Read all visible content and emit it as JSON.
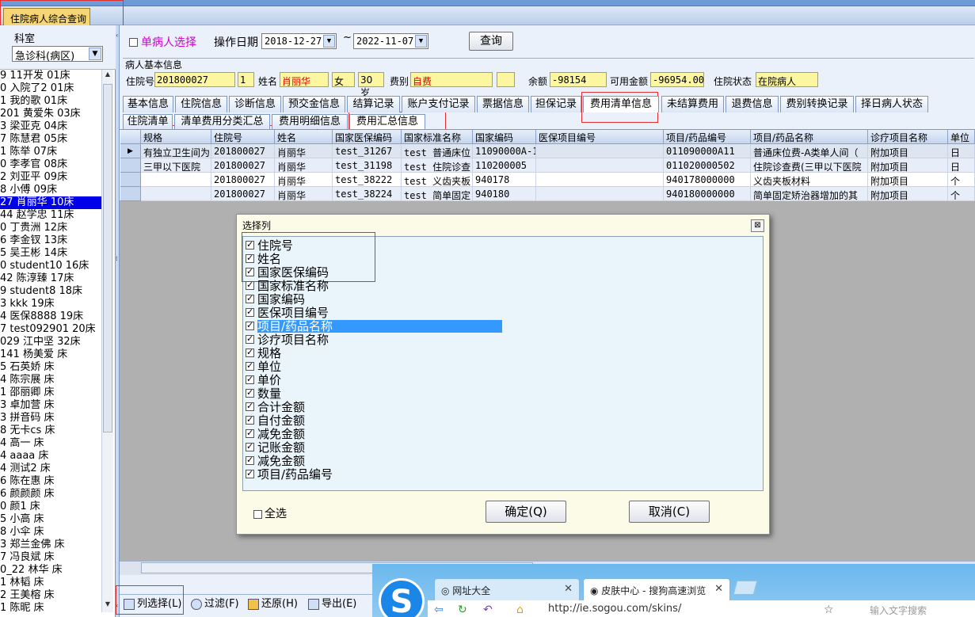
{
  "window": {
    "tab_title": "住院病人综合查询"
  },
  "left_panel": {
    "dept_label": "科室",
    "dept_value": "急诊科(病区)",
    "patients": [
      "9 11开发 01床",
      "0 入院了2 01床",
      "1 我的歌 01床",
      "201 黄爱朱 03床",
      "3 梁亚克 04床",
      "7 陈慧君 05床",
      "1 陈举 07床",
      "0 李孝官 08床",
      "2 刘亚平 09床",
      "8 小傅 09床",
      "27 肖丽华 10床",
      "44 赵学忠 11床",
      "0 丁贵洲 12床",
      "6 李金钗 13床",
      "5 吴王彬 14床",
      "0 student10 16床",
      "42 陈淳臻 17床",
      "9 student8 18床",
      "3 kkk 19床",
      "4 医保8888 19床",
      "7 test092901 20床",
      "029 江中坚 32床",
      "141 杨美爱 床",
      "5 石英娇 床",
      "4 陈宗展 床",
      "1 邵丽卿 床",
      "3 卓加营 床",
      "3 拼音码 床",
      "8 无卡cs 床",
      "4 高一 床",
      "4 aaaa 床",
      "4 测试2 床",
      "6 陈在惠 床",
      "6 颜颜颜 床",
      "0 颜1 床",
      "5 小高 床",
      "8 小伞 床",
      "3 郑兰金佛 床",
      "7 冯良斌 床",
      "0_22 林华 床",
      "1 林韬 床",
      "2 王美榕 床",
      "1 陈昵 床"
    ],
    "selected_index": 10
  },
  "query": {
    "single_patient_label": "单病人选择",
    "op_date_label": "操作日期",
    "date_from": "2018-12-27",
    "tilde": "~",
    "date_to": "2022-11-07",
    "query_button": "查询"
  },
  "basic_info": {
    "group_title": "病人基本信息",
    "admission_no_label": "住院号",
    "admission_no": "201800027",
    "bed": "1",
    "name_label": "姓名",
    "name": "肖丽华",
    "sex": "女",
    "age": "30岁",
    "fee_type_label": "费别",
    "fee_type": "自费",
    "balance_label": "余额",
    "balance": "-98154",
    "available_label": "可用金额",
    "available": "-96954.00",
    "status_label": "住院状态",
    "status": "在院病人"
  },
  "tabs": [
    "基本信息",
    "住院信息",
    "诊断信息",
    "预交金信息",
    "结算记录",
    "账户支付记录",
    "票据信息",
    "担保记录",
    "费用清单信息",
    "未结算费用",
    "退费信息",
    "费别转换记录",
    "择日病人状态"
  ],
  "subtabs": [
    "住院清单",
    "清单费用分类汇总",
    "费用明细信息",
    "费用汇总信息"
  ],
  "grid": {
    "columns": [
      "规格",
      "住院号",
      "姓名",
      "国家医保编码",
      "国家标准名称",
      "国家编码",
      "医保项目编号",
      "项目/药品编号",
      "项目/药品名称",
      "诊疗项目名称",
      "单位"
    ],
    "rows": [
      [
        "有独立卫生间为",
        "201800027",
        "肖丽华",
        "test_31267",
        "test_普通床位",
        "11090000A-1",
        "",
        "011090000A11",
        "普通床位费-A类单人间（",
        "附加项目",
        "日"
      ],
      [
        "三甲以下医院",
        "201800027",
        "肖丽华",
        "test_31198",
        "test_住院诊查",
        "110200005",
        "",
        "011020000502",
        "住院诊查费(三甲以下医院",
        "附加项目",
        "日"
      ],
      [
        "",
        "201800027",
        "肖丽华",
        "test_38222",
        "test_义齿夹板",
        "940178",
        "",
        "940178000000",
        "义齿夹板材料",
        "附加项目",
        "个"
      ],
      [
        "",
        "201800027",
        "肖丽华",
        "test_38224",
        "test_简单固定",
        "940180",
        "",
        "940180000000",
        "简单固定矫治器增加的其",
        "附加项目",
        "个"
      ]
    ]
  },
  "toolbar": {
    "col_select": "列选择(L)",
    "filter": "过滤(F)",
    "restore": "还原(H)",
    "export": "导出(E)"
  },
  "dialog": {
    "title": "选择列",
    "close": "⊠",
    "options": [
      "住院号",
      "姓名",
      "国家医保编码",
      "国家标准名称",
      "国家编码",
      "医保项目编号",
      "项目/药品名称",
      "诊疗项目名称",
      "规格",
      "单位",
      "单价",
      "数量",
      "合计金额",
      "自付金额",
      "减免金额",
      "记账金额",
      "减免金额",
      "项目/药品编号"
    ],
    "highlighted_index": 6,
    "select_all": "全选",
    "ok": "确定(Q)",
    "cancel": "取消(C)"
  },
  "browser": {
    "tab1": "网址大全",
    "tab2": "皮肤中心 - 搜狗高速浏览",
    "url": "http://ie.sogou.com/skins/",
    "search_placeholder": "输入文字搜索"
  }
}
